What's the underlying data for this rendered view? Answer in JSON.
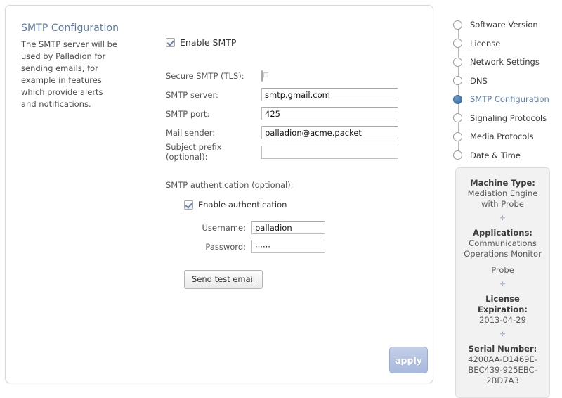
{
  "panel": {
    "title": "SMTP Configuration",
    "intro": "The SMTP server will be used by Palladion for sending emails, for example in features which provide alerts and notifications."
  },
  "form": {
    "enable_smtp": {
      "label": "Enable SMTP",
      "checked": true
    },
    "fields": [
      {
        "label": "Secure SMTP (TLS):",
        "type": "checkbox",
        "checked": false
      },
      {
        "label": "SMTP server:",
        "type": "text",
        "value": "smtp.gmail.com",
        "placeholder": ""
      },
      {
        "label": "SMTP port:",
        "type": "text",
        "value": "425",
        "placeholder": ""
      },
      {
        "label": "Mail sender:",
        "type": "text",
        "value": "palladion@acme.packet",
        "placeholder": ""
      },
      {
        "label": "Subject prefix (optional):",
        "type": "text",
        "value": "",
        "placeholder": ""
      }
    ],
    "auth_heading": "SMTP authentication (optional):",
    "enable_auth": {
      "label": "Enable authentication",
      "checked": true
    },
    "auth_fields": [
      {
        "label": "Username:",
        "type": "text",
        "value": "palladion",
        "placeholder": ""
      },
      {
        "label": "Password:",
        "type": "password",
        "value": "······",
        "placeholder": ""
      }
    ],
    "send_test_email_label": "Send test email",
    "apply_label": "apply"
  },
  "nav": {
    "items": [
      {
        "label": "Software Version",
        "active": false
      },
      {
        "label": "License",
        "active": false
      },
      {
        "label": "Network Settings",
        "active": false
      },
      {
        "label": "DNS",
        "active": false
      },
      {
        "label": "SMTP Configuration",
        "active": true
      },
      {
        "label": "Signaling Protocols",
        "active": false
      },
      {
        "label": "Media Protocols",
        "active": false
      },
      {
        "label": "Date & Time",
        "active": false
      }
    ]
  },
  "info": {
    "separator": "✛",
    "blocks": [
      {
        "title": "Machine Type:",
        "lines": [
          "Mediation Engine with Probe"
        ]
      },
      {
        "title": "Applications:",
        "lines": [
          "Communications Operations Monitor",
          "Probe"
        ]
      },
      {
        "title": "License Expiration:",
        "lines": [
          "2013-04-29"
        ]
      },
      {
        "title": "Serial Number:",
        "lines": [
          "4200AA-D1469E-BEC439-925EBC-2BD7A3"
        ]
      }
    ]
  },
  "colors": {
    "accent": "#5c7ba8",
    "active_dot": "#3f77ad",
    "apply_button": "#a7b9dd",
    "panel_border": "#d8d8d8",
    "info_bg": "#f2f2f2"
  }
}
